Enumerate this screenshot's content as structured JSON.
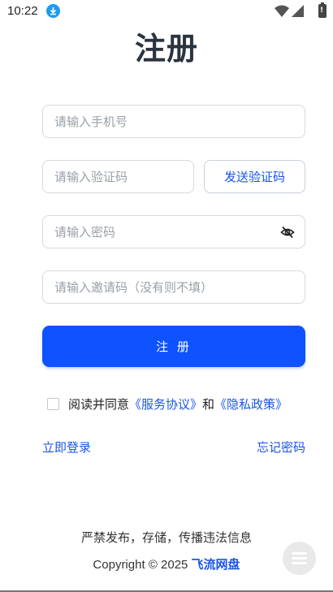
{
  "status_bar": {
    "time": "10:22"
  },
  "page": {
    "title": "注册"
  },
  "form": {
    "phone_placeholder": "请输入手机号",
    "code_placeholder": "请输入验证码",
    "send_code_label": "发送验证码",
    "password_placeholder": "请输入密码",
    "invite_placeholder": "请输入邀请码（没有则不填）",
    "register_label": "注 册"
  },
  "agreement": {
    "prefix": "阅读并同意",
    "service_link": "《服务协议》",
    "conjunction": "和",
    "privacy_link": "《隐私政策》",
    "checked": false
  },
  "links": {
    "login": "立即登录",
    "forgot": "忘记密码"
  },
  "footer": {
    "notice": "严禁发布，存储，传播违法信息",
    "copyright": "Copyright © 2025",
    "brand": "飞流网盘"
  },
  "colors": {
    "accent": "#0f52ff",
    "link": "#1a55e6",
    "title": "#2a3440"
  },
  "icons": {
    "download": "download-icon",
    "wifi": "wifi-icon",
    "signal": "signal-icon",
    "battery": "battery-icon",
    "password_toggle": "eye-off-icon",
    "float_menu": "menu-icon"
  }
}
